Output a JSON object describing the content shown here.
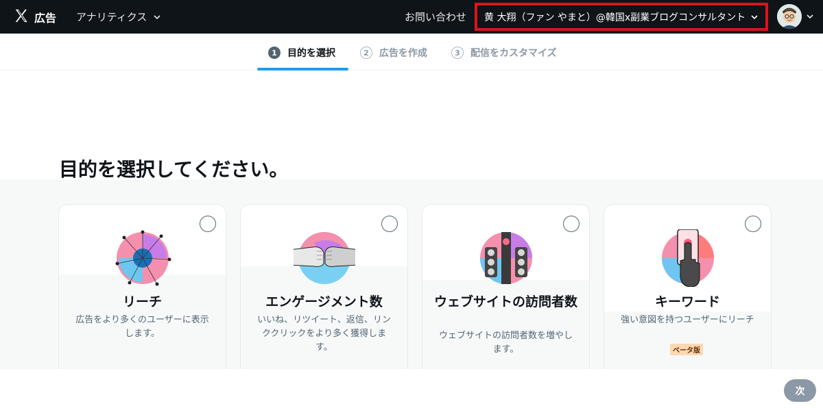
{
  "header": {
    "brand": "広告",
    "analytics_label": "アナリティクス",
    "contact_label": "お問い合わせ",
    "account_name": "黄 大翔（ファン やまと）@韓国x副業ブログコンサルタント"
  },
  "steps": [
    {
      "num": "1",
      "label": "目的を選択",
      "state": "active"
    },
    {
      "num": "2",
      "label": "広告を作成",
      "state": "inactive"
    },
    {
      "num": "3",
      "label": "配信をカスタマイズ",
      "state": "inactive"
    }
  ],
  "page": {
    "title": "目的を選択してください。"
  },
  "cards": [
    {
      "title": "リーチ",
      "description": "広告をより多くのユーザーに表示します。"
    },
    {
      "title": "エンゲージメント数",
      "description": "いいね、リツイート、返信、リンククリックをより多く獲得します。"
    },
    {
      "title": "ウェブサイトの訪問者数",
      "description": "ウェブサイトの訪問者数を増やします。"
    },
    {
      "title": "キーワード",
      "description": "強い意図を持つユーザーにリーチ",
      "badge": "ベータ版"
    }
  ],
  "footer": {
    "next_label": "次"
  },
  "colors": {
    "header_bg": "#0f1419",
    "highlight_border": "#e0121a",
    "active_underline": "#1d9bf0",
    "beta_badge_bg": "#ffd8b3"
  }
}
